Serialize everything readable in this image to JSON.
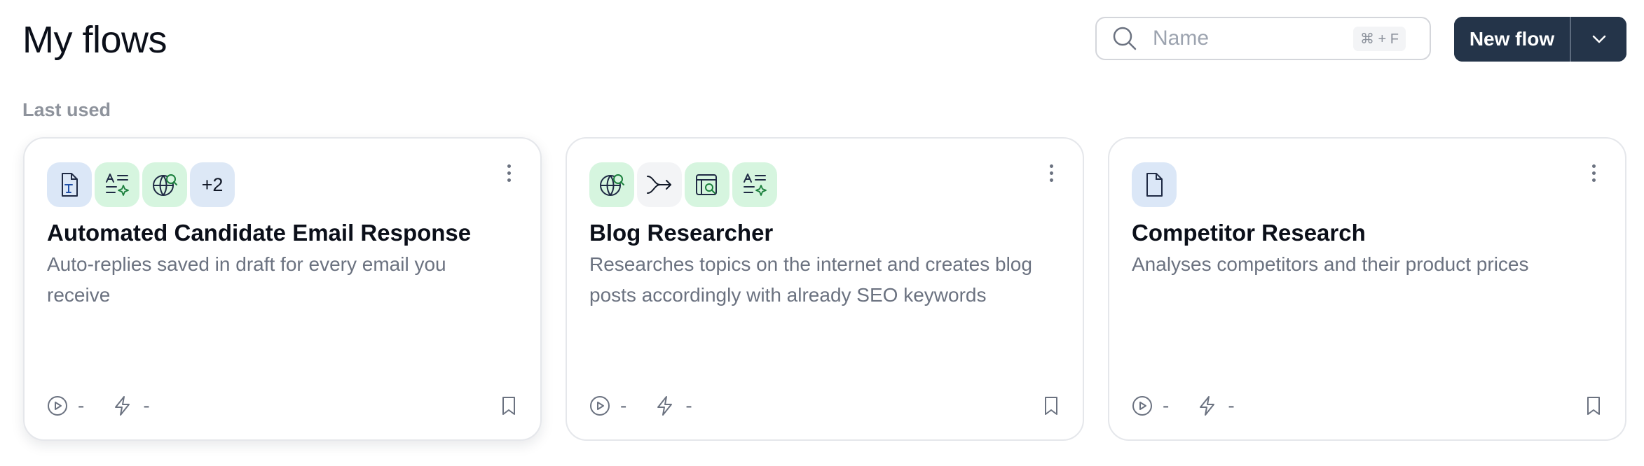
{
  "page": {
    "title": "My flows"
  },
  "search": {
    "placeholder": "Name",
    "shortcut": "⌘ + F"
  },
  "new_flow": {
    "label": "New flow"
  },
  "section": {
    "label": "Last used"
  },
  "cards": [
    {
      "title": "Automated Candidate Email Response",
      "description": "Auto-replies saved in draft for every email you receive",
      "icons": [
        "text-document-icon",
        "text-sparkle-icon",
        "globe-search-icon"
      ],
      "more_count": "+2",
      "runs": "-",
      "triggers": "-"
    },
    {
      "title": "Blog Researcher",
      "description": "Researches topics on the internet and creates blog posts accordingly with already SEO keywords",
      "icons": [
        "globe-search-icon",
        "merge-arrow-icon",
        "web-search-icon",
        "text-sparkle-icon"
      ],
      "runs": "-",
      "triggers": "-"
    },
    {
      "title": "Competitor Research",
      "description": "Analyses competitors and their product prices",
      "icons": [
        "document-icon"
      ],
      "runs": "-",
      "triggers": "-"
    }
  ],
  "colors": {
    "primary_button": "#243449",
    "icon_tile_blue": "#dbe7f7",
    "icon_tile_green": "#d6f5df",
    "icon_tile_grey": "#f3f4f6",
    "muted_text": "#6b7280"
  }
}
